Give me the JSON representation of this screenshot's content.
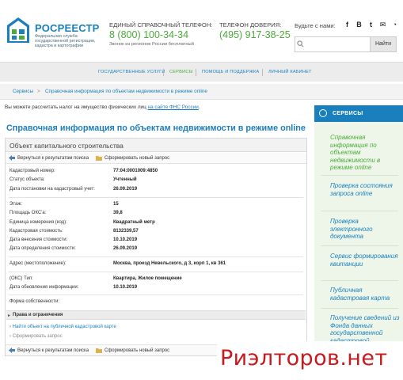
{
  "header": {
    "brand": "РОСРЕЕСТР",
    "brand_sub": "Федеральная служба государственной регистрации, кадастра и картографии",
    "phone1_label": "ЕДИНЫЙ СПРАВОЧНЫЙ ТЕЛЕФОН:",
    "phone1": "8 (800) 100-34-34",
    "phone1_note": "Звонок из регионов России бесплатный",
    "phone2_label": "ТЕЛЕФОН ДОВЕРИЯ:",
    "phone2": "(495) 917-38-25",
    "social_label": "Будьте с нами:",
    "social": [
      "f",
      "B",
      "t",
      "@",
      "rss"
    ],
    "search_placeholder": "",
    "search_button": "Найти"
  },
  "nav": {
    "items": [
      "ГОСУДАРСТВЕННЫЕ УСЛУГИ",
      "СЕРВИСЫ",
      "ПОМОЩЬ И ПОДДЕРЖКА",
      "ЛИЧНЫЙ КАБИНЕТ"
    ],
    "active_index": 1
  },
  "breadcrumb": {
    "items": [
      "Сервисы",
      "Справочная информация по объектам недвижимости в режиме online"
    ]
  },
  "info": {
    "text": "Вы можете рассчитать налог на имущество физических лиц ",
    "link": "на сайте ФНС России",
    "tail": "."
  },
  "page_title": "Справочная информация по объектам недвижимости в режиме online",
  "card": {
    "title": "Объект капитального строительства",
    "back_button": "Вернуться к результатам поиска",
    "new_request_button": "Сформировать новый запрос",
    "group1": [
      {
        "label": "Кадастровый номер:",
        "value": "77:04:0001009:4850"
      },
      {
        "label": "Статус объекта:",
        "value": "Учтенный"
      },
      {
        "label": "Дата постановки на кадастровый учет:",
        "value": "26.09.2019"
      }
    ],
    "group2": [
      {
        "label": "Этаж:",
        "value": "15"
      },
      {
        "label": "Площадь ОКС'a:",
        "value": "39,8"
      },
      {
        "label": "Единица измерения (код):",
        "value": "Квадратный метр"
      },
      {
        "label": "Кадастровая стоимость:",
        "value": "8132339,57"
      },
      {
        "label": "Дата внесения стоимости:",
        "value": "10.10.2019"
      },
      {
        "label": "Дата определения стоимости:",
        "value": "26.09.2019"
      }
    ],
    "address": {
      "label": "Адрес (местоположение):",
      "value": "Москва, проезд Невельского, д 3, корп 1, кв 361"
    },
    "group3": [
      {
        "label": "(ОКС) Тип:",
        "value": "Квартира, Жилое помещение"
      },
      {
        "label": "Дата обновления информации:",
        "value": "10.10.2019"
      }
    ],
    "ownership_label": "Форма собственности:",
    "rights_label": "Права и ограничения",
    "map_link": "Найти объект на публичной кадастровой карте",
    "form_request": "Сформировать запрос"
  },
  "sidebar": {
    "title": "СЕРВИСЫ",
    "items": [
      "Справочная информация по объектам недвижимости в режиме online",
      "Проверка состояния запроса online",
      "Проверка электронного документа",
      "Сервис формирования квитанции",
      "Публичная кадастровая карта",
      "Получение сведений из Фонда данных государственной кадастровой"
    ],
    "active_index": 0
  },
  "watermark": "Риэлторов.нет",
  "colors": {
    "brand_blue": "#1a7fbd",
    "green": "#4caa3a",
    "watermark_red": "#c8191c"
  }
}
